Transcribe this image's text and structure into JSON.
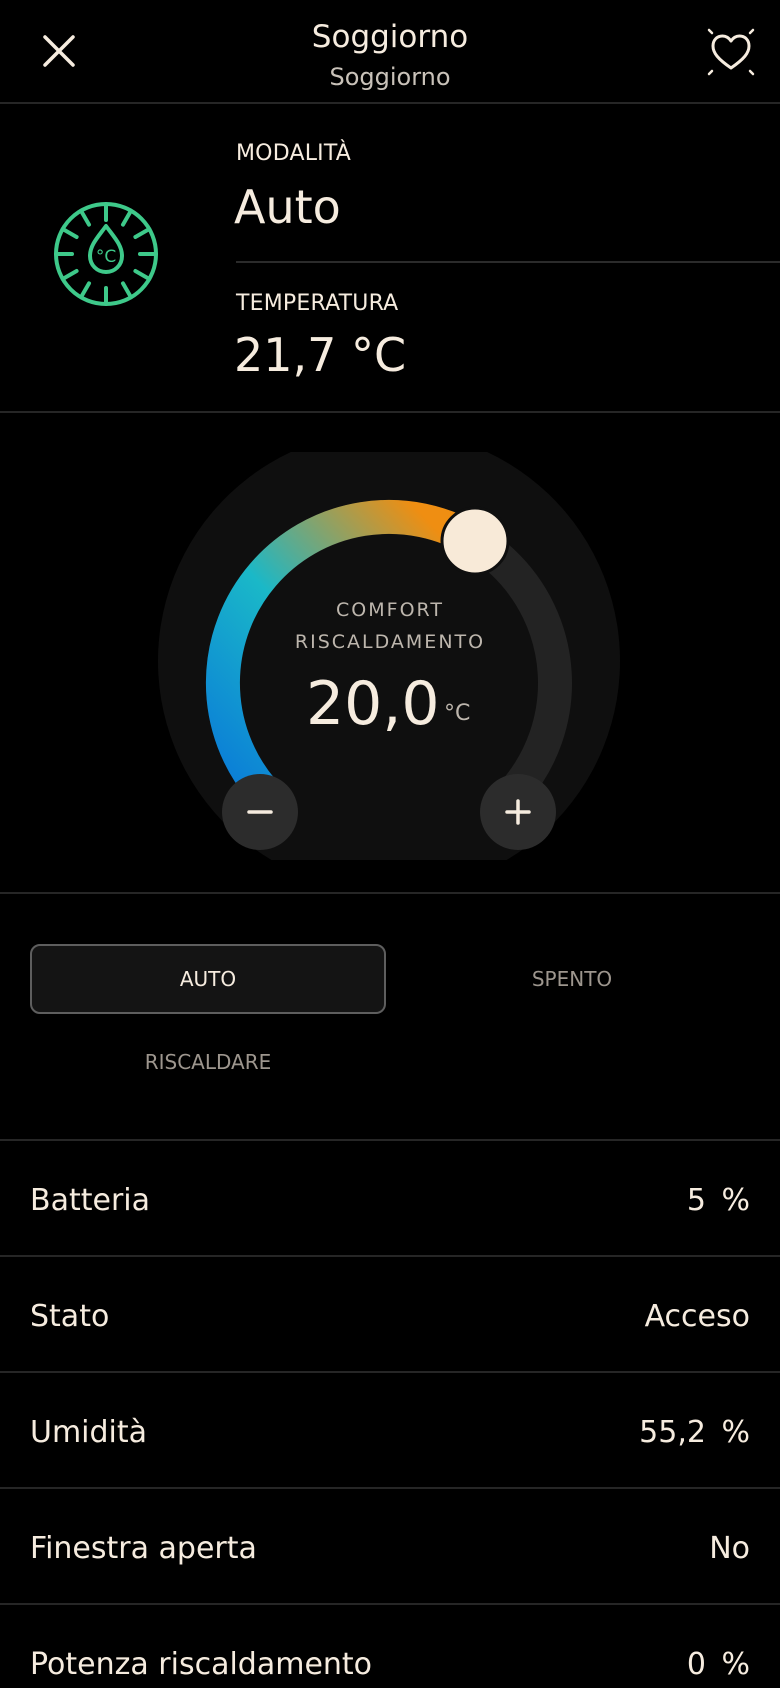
{
  "header": {
    "title": "Soggiorno",
    "subtitle": "Soggiorno",
    "close_icon": "close-icon",
    "favorite_icon": "heart-sparkle-icon"
  },
  "info": {
    "mode_label": "MODALITÀ",
    "mode_value": "Auto",
    "temperature_label": "TEMPERATURA",
    "temperature_value": "21,7 °C",
    "device_icon": "thermostat-icon",
    "device_icon_text": "°C",
    "accent_color": "#3ec98a"
  },
  "dial": {
    "label_line1": "COMFORT",
    "label_line2": "RISCALDAMENTO",
    "setpoint": "20,0",
    "unit": "°C",
    "setpoint_fraction": 0.62,
    "gradient_colors": [
      "#0a7ad8",
      "#1ab8c8",
      "#ef8e12"
    ],
    "decrease_icon": "minus-icon",
    "increase_icon": "plus-icon"
  },
  "modes": {
    "items": [
      "AUTO",
      "SPENTO",
      "RISCALDARE"
    ],
    "selected": "AUTO"
  },
  "attributes": [
    {
      "label": "Batteria",
      "value": "5 %"
    },
    {
      "label": "Stato",
      "value": "Acceso"
    },
    {
      "label": "Umidità",
      "value": "55,2 %"
    },
    {
      "label": "Finestra aperta",
      "value": "No"
    },
    {
      "label": "Potenza riscaldamento",
      "value": "0 %"
    }
  ]
}
